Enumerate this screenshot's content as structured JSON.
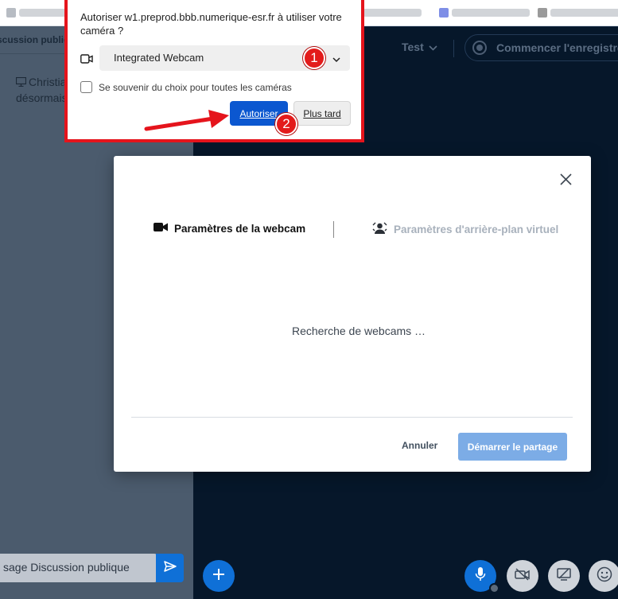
{
  "chat": {
    "title": "scussion publique",
    "message_author": "Christia",
    "message_text": "désormais",
    "input_placeholder": "sage Discussion publique"
  },
  "header": {
    "session_name": "Test",
    "record_label": "Commencer l'enregistreme"
  },
  "permission_prompt": {
    "text": "Autoriser w1.preprod.bbb.numerique-esr.fr à utiliser votre caméra ?",
    "camera_selected": "Integrated Webcam",
    "remember_label": "Se souvenir du choix pour toutes les caméras",
    "allow_label": "Autoriser",
    "later_label": "Plus tard",
    "annotation_1": "1",
    "annotation_2": "2",
    "highlight_color": "#e5141c"
  },
  "webcam_modal": {
    "tab_webcam": "Paramètres de la webcam",
    "tab_background": "Paramètres d'arrière-plan virtuel",
    "searching_text": "Recherche de webcams  …",
    "cancel_label": "Annuler",
    "start_label": "Démarrer le partage"
  },
  "colors": {
    "primary": "#0f70d7",
    "allow_button": "#0b57d0",
    "start_button_disabled": "#7cace6",
    "meeting_bg": "#06172a",
    "chat_bg": "#4b5b6d"
  }
}
